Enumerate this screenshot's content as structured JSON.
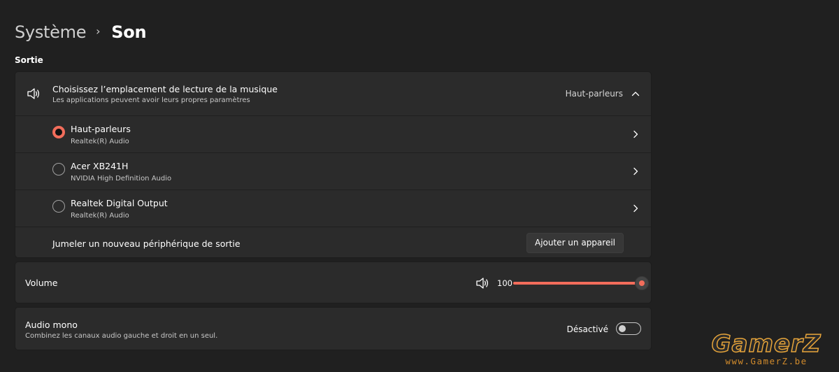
{
  "header": {
    "parent": "Système",
    "separator": "›",
    "current": "Son"
  },
  "output_section": {
    "label": "Sortie",
    "selector": {
      "title": "Choisissez l’emplacement de lecture de la musique",
      "subtitle": "Les applications peuvent avoir leurs propres paramètres",
      "selected_value": "Haut-parleurs",
      "icon": "speaker-icon",
      "expanded": true
    },
    "devices": [
      {
        "name": "Haut-parleurs",
        "driver": "Realtek(R) Audio",
        "selected": true
      },
      {
        "name": "Acer XB241H",
        "driver": "NVIDIA High Definition Audio",
        "selected": false
      },
      {
        "name": "Realtek Digital Output",
        "driver": "Realtek(R) Audio",
        "selected": false
      }
    ],
    "pair": {
      "label": "Jumeler un nouveau périphérique de sortie",
      "button_label": "Ajouter un appareil"
    }
  },
  "volume": {
    "label": "Volume",
    "value": "100",
    "level": 1.0,
    "icon": "speaker-icon"
  },
  "mono": {
    "title": "Audio mono",
    "subtitle": "Combinez les canaux audio gauche et droit en un seul.",
    "state_label": "Désactivé",
    "enabled": false
  },
  "watermark": {
    "logo": "GamerZ",
    "url": "www.GamerZ.be"
  },
  "colors": {
    "background": "#202020",
    "card": "#2b2b2b",
    "accent": "#f26d5b",
    "watermark": "#e6a43a"
  }
}
